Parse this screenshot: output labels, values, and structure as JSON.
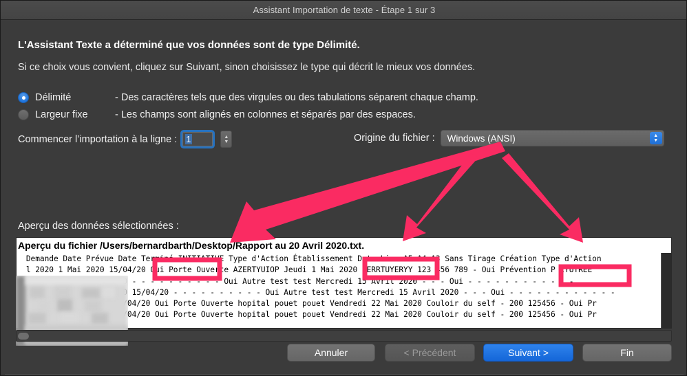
{
  "window": {
    "title": "Assistant Importation de texte - Étape 1 sur 3"
  },
  "main": {
    "headline": "L'Assistant Texte a déterminé que vos données sont de type Délimité.",
    "subline": "Si ce choix vous convient, cliquez sur Suivant, sinon choisissez le type qui décrit le mieux vos données."
  },
  "type_options": [
    {
      "id": "delimite",
      "label": "Délimité",
      "description": "- Des caractères tels que des virgules ou des tabulations séparent chaque champ.",
      "selected": true
    },
    {
      "id": "largeur-fixe",
      "label": "Largeur fixe",
      "description": "- Les champs sont alignés en colonnes et séparés par des espaces.",
      "selected": false
    }
  ],
  "start_line": {
    "label": "Commencer l’importation à la ligne :",
    "value": "1",
    "stepper_up_icon": "chevron-up-icon",
    "stepper_down_icon": "chevron-down-icon"
  },
  "file_origin": {
    "label": "Origine du fichier :",
    "value": "Windows (ANSI)",
    "popup_icon": "chevron-up-down-icon"
  },
  "preview": {
    "label": "Aperçu des données sélectionnées :",
    "filename_line": "Aperçu du fichier /Users/bernardbarth/Desktop/Rapport au 20 Avril 2020.txt.",
    "rows": [
      "          Demande Date Prévue Date Terminé INITIATIVE Type d'Action Établissement Date Lieu A5 A4 A3 Sans Tirage Création Type d'Action",
      "          l 2020 1 Mai 2020 15/04/20 Oui Porte Ouverte AZERTYUIOP Jeudi 1 Mai 2020 ZERRTUYERYY 123 456 789 - Oui Prévention P IYUTREE",
      "          ril 2020 30 Avril 2020 - - - - - - - - - - Oui Autre test test Mercredi 15 Avril 2020 - - - Oui - - - - - - - - - - - -",
      "          ril 2020 30 Avril 2020 15/04/20 - - - - - - - - - - Oui Autre test test Mercredi 15 Avril 2020 - - - Oui - - - - - - - - - - - -",
      "          2020 30 Avril 2020 15/04/20 Oui Porte Ouverte hopital pouet pouet Vendredi 22 Mai 2020 Couloir du self - 200 125456 - Oui Pr",
      "          2020 30 Avril 2020 15/04/20 Oui Porte Ouverte hopital pouet pouet Vendredi 22 Mai 2020 Couloir du self - 200 125456 - Oui Pr"
    ]
  },
  "buttons": [
    {
      "id": "annuler",
      "label": "Annuler",
      "state": "normal"
    },
    {
      "id": "precedent",
      "label": "< Précédent",
      "state": "disabled"
    },
    {
      "id": "suivant",
      "label": "Suivant >",
      "state": "primary"
    },
    {
      "id": "fin",
      "label": "Fin",
      "state": "normal"
    }
  ],
  "annotations": {
    "color": "#fa2b62",
    "highlight_boxes": [
      {
        "id": "date-prevue",
        "label": "Date Prévue"
      },
      {
        "id": "etablissement",
        "label": "Établissement"
      },
      {
        "id": "prevention",
        "label": "Prévention P"
      }
    ]
  },
  "colors": {
    "accent_blue": "#1f6fd6",
    "annotation_pink": "#fa2b62",
    "window_background": "#3b3b3b",
    "preview_background": "#ffffff"
  }
}
